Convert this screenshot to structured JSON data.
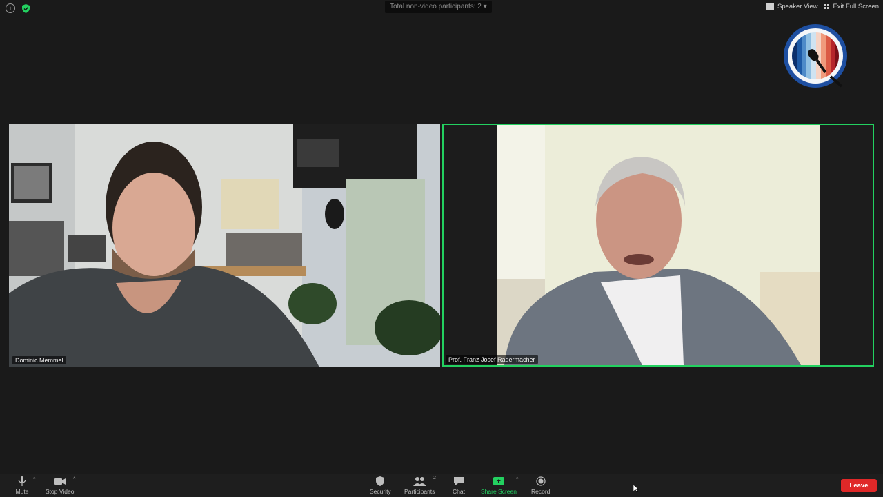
{
  "top_bar": {
    "non_video_participants": "Total non-video participants: 2 ▾",
    "speaker_view": "Speaker View",
    "exit_full_screen": "Exit Full Screen"
  },
  "logo": {
    "alt": "Scientists for Future Leipzig"
  },
  "participants": [
    {
      "name": "Dominic Memmel",
      "active_speaker": false
    },
    {
      "name": "Prof. Franz Josef Radermacher",
      "active_speaker": true
    }
  ],
  "toolbar": {
    "mute": "Mute",
    "stop_video": "Stop Video",
    "security": "Security",
    "participants": "Participants",
    "participants_count": "2",
    "chat": "Chat",
    "share_screen": "Share Screen",
    "record": "Record",
    "leave": "Leave"
  },
  "colors": {
    "active_speaker_border": "#23d160",
    "leave_button": "#e02828",
    "share_screen": "#23d160",
    "background": "#1a1a1a"
  },
  "icons": [
    "info-icon",
    "shield-icon",
    "speaker-view-icon",
    "exit-fullscreen-icon",
    "microphone-icon",
    "video-camera-icon",
    "security-icon",
    "participants-icon",
    "chat-icon",
    "share-screen-icon",
    "record-icon",
    "mouse-cursor-icon"
  ]
}
